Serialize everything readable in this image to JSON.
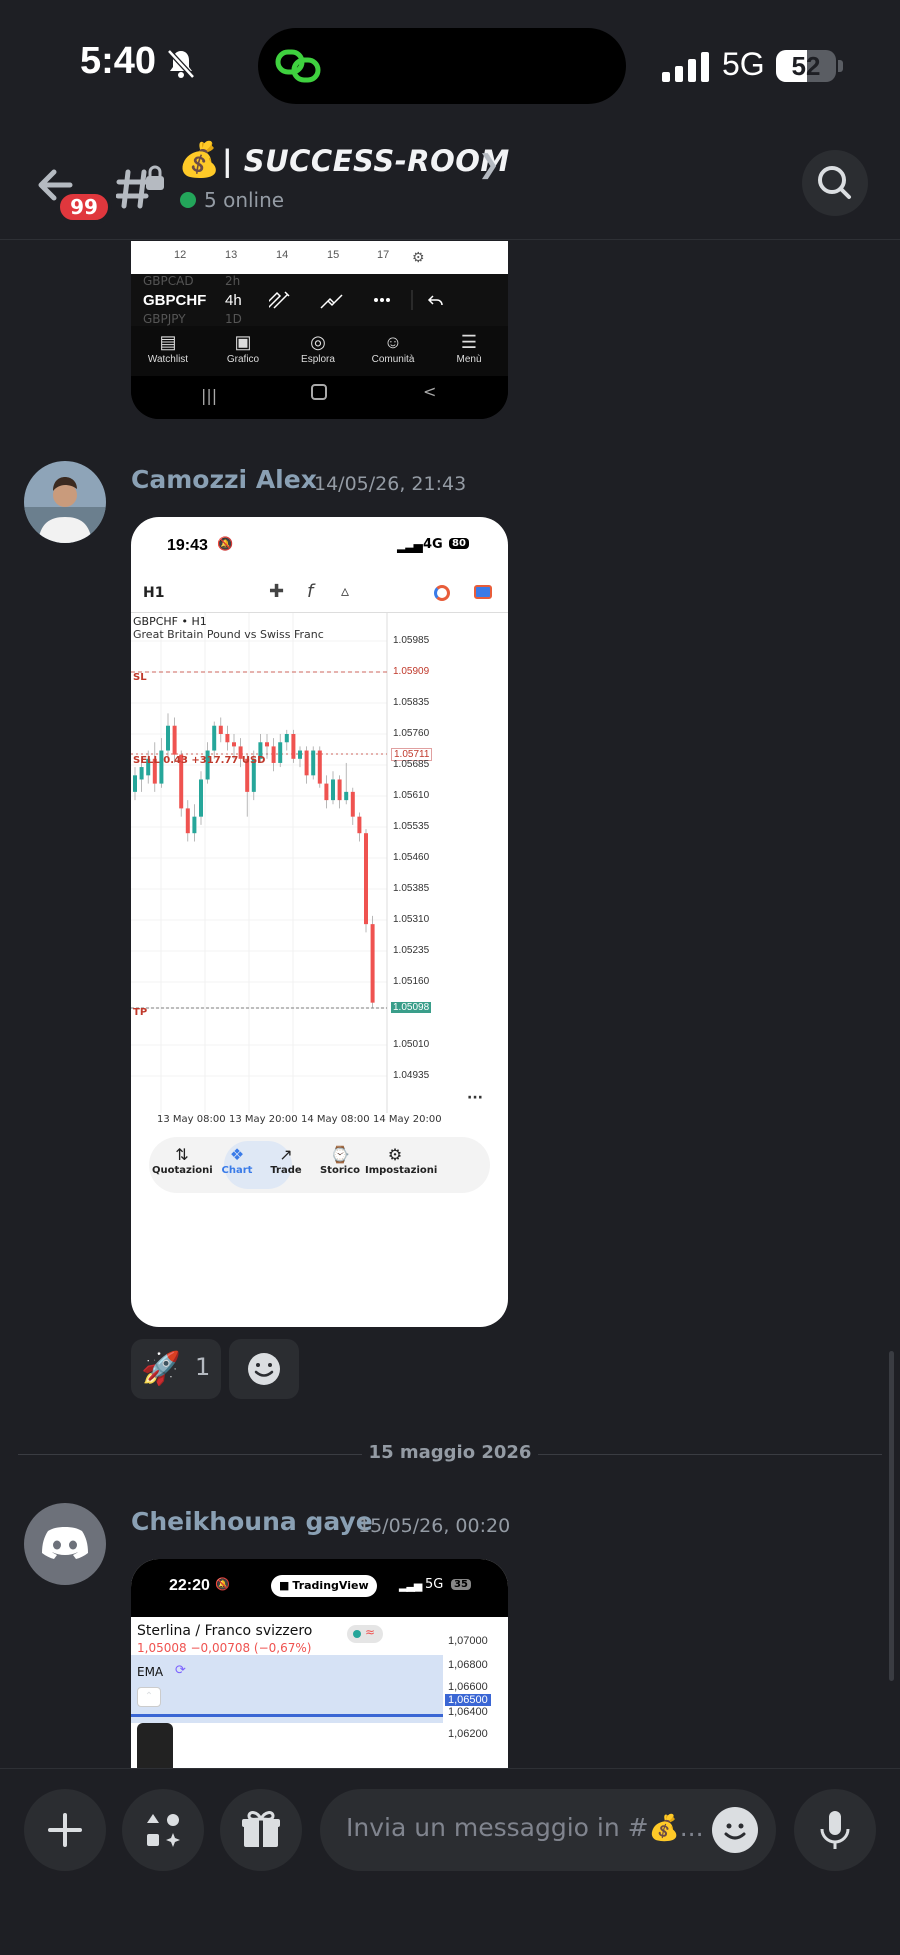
{
  "status_bar": {
    "time": "5:40",
    "network": "5G",
    "battery": "52",
    "battery_level": 0.52
  },
  "header": {
    "badge_count": "99",
    "channel_emoji": "💰",
    "channel_name": "| SUCCESS-ROOM",
    "online_text": "5 online"
  },
  "message1_shot": {
    "axis_ticks": [
      "12",
      "13",
      "14",
      "15",
      "17"
    ],
    "pair_prev": "GBPCAD",
    "pair_prev_tf": "2h",
    "pair": "GBPCHF",
    "timeframe": "4h",
    "pair_next": "GBPJPY",
    "pair_next_tf": "1D",
    "tabs": [
      "Watchlist",
      "Grafico",
      "Esplora",
      "Comunità",
      "Menù"
    ]
  },
  "message2": {
    "author": "Camozzi Alex",
    "timestamp": "14/05/26, 21:43",
    "shot": {
      "time": "19:43",
      "network": "4G",
      "battery": "80",
      "timeframe": "H1",
      "symbol": "GBPCHF • H1",
      "description": "Great Britain Pound vs Swiss Franc",
      "sl_label": "SL",
      "sell_label": "SELL 0.43 +317.77 USD",
      "tp_label": "TP",
      "price_ticks": [
        "1.05985",
        "1.05909",
        "1.05835",
        "1.05760",
        "1.05711",
        "1.05685",
        "1.05610",
        "1.05535",
        "1.05460",
        "1.05385",
        "1.05310",
        "1.05235",
        "1.05160",
        "1.05098",
        "1.05010",
        "1.04935"
      ],
      "time_ticks": [
        "13 May 08:00",
        "13 May 20:00",
        "14 May 08:00",
        "14 May 20:00"
      ],
      "nav_tabs": [
        "Quotazioni",
        "Chart",
        "Trade",
        "Storico",
        "Impostazioni"
      ]
    },
    "reaction": {
      "emoji": "🚀",
      "count": "1"
    }
  },
  "divider": {
    "date": "15 maggio 2026"
  },
  "message3": {
    "author": "Cheikhouna gaye",
    "timestamp": "15/05/26, 00:20",
    "shot": {
      "time": "22:20",
      "app": "TradingView",
      "network": "5G",
      "battery": "35",
      "symbol": "Sterlina / Franco svizzero",
      "quote": "1,05008 −0,00708 (−0,67%)",
      "indicator": "EMA",
      "price_ticks": [
        "1,07000",
        "1,06800",
        "1,06600",
        "1,06500",
        "1,06400",
        "1,06200"
      ]
    }
  },
  "composer": {
    "placeholder": "Invia un messaggio in #💰..."
  },
  "colors": {
    "background": "#1e1f24",
    "bubble": "#2b2d31",
    "badge": "#e0373d",
    "online": "#23a55a",
    "bull": "#26a69a",
    "bear": "#ef5350"
  }
}
